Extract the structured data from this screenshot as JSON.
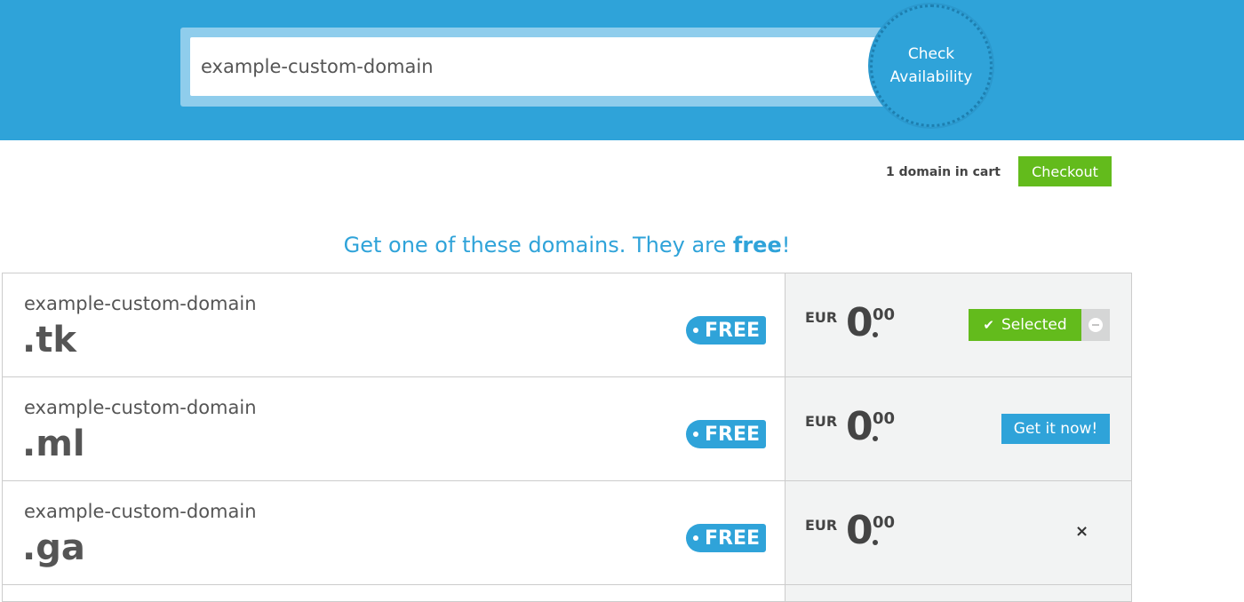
{
  "search": {
    "value": "example-custom-domain",
    "button_line1": "Check",
    "button_line2": "Availability"
  },
  "cart": {
    "count_text": "1 domain in cart",
    "checkout_label": "Checkout"
  },
  "headline": {
    "prefix": "Get one of these domains. They are ",
    "emphasis": "free",
    "suffix": "!"
  },
  "domains": [
    {
      "name": "example-custom-domain",
      "tld": ".tk",
      "badge": "FREE",
      "currency": "EUR",
      "price_int": "0",
      "price_dec": "00",
      "action": "selected",
      "action_label": "Selected"
    },
    {
      "name": "example-custom-domain",
      "tld": ".ml",
      "badge": "FREE",
      "currency": "EUR",
      "price_int": "0",
      "price_dec": "00",
      "action": "get",
      "action_label": "Get it now!"
    },
    {
      "name": "example-custom-domain",
      "tld": ".ga",
      "badge": "FREE",
      "currency": "EUR",
      "price_int": "0",
      "price_dec": "00",
      "action": "remove",
      "action_label": "×"
    }
  ],
  "colors": {
    "brand_blue": "#2fa3d9",
    "cart_green": "#63bb1c"
  },
  "icons": {
    "selected": "check-icon",
    "remove": "minus-circle-icon",
    "close": "close-icon"
  }
}
